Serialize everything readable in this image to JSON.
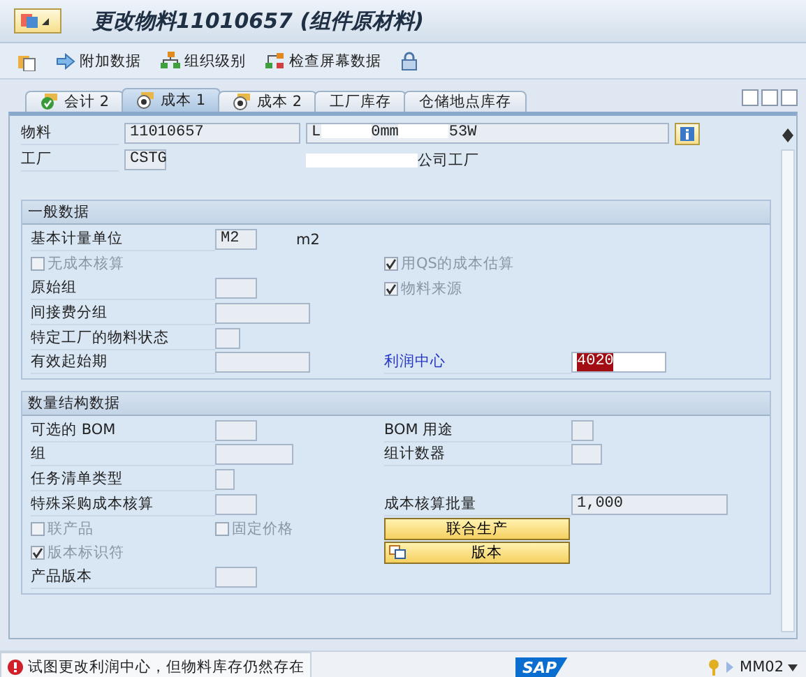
{
  "window": {
    "title": "更改物料11010657 (组件原材料)"
  },
  "toolbar": [
    {
      "kind": "new"
    },
    {
      "kind": "arrow",
      "label": "附加数据"
    },
    {
      "kind": "org",
      "label": "组织级别"
    },
    {
      "kind": "check",
      "label": "检查屏幕数据"
    },
    {
      "kind": "lock"
    }
  ],
  "tabs": [
    {
      "label": "会计 2",
      "kind": "ok",
      "selected": false
    },
    {
      "label": "成本 1",
      "kind": "target",
      "selected": true
    },
    {
      "label": "成本 2",
      "kind": "target",
      "selected": false
    },
    {
      "label": "工厂库存",
      "kind": "plain",
      "selected": false
    },
    {
      "label": "仓储地点库存",
      "kind": "plain",
      "selected": false
    }
  ],
  "header": {
    "material_label": "物料",
    "material": "11010657",
    "description_parts": [
      "L",
      "0mm",
      "53W"
    ],
    "plant_label": "工厂",
    "plant": "CSTG",
    "plant_name": "公司工厂"
  },
  "sections": [
    {
      "title": "一般数据",
      "rows": [
        {
          "left": {
            "kind": "field",
            "label": "基本计量单位",
            "value": "M2",
            "note": "m2"
          }
        },
        {
          "left": {
            "kind": "checkbox",
            "label": "无成本核算",
            "checked": false,
            "disabled": true
          },
          "right": {
            "kind": "checkbox",
            "label": "用QS的成本估算",
            "checked": true,
            "disabled": true
          }
        },
        {
          "left": {
            "kind": "field",
            "label": "原始组"
          },
          "right": {
            "kind": "checkbox",
            "label": "物料来源",
            "checked": true,
            "disabled": true
          }
        },
        {
          "left": {
            "kind": "field",
            "label": "间接费分组"
          }
        },
        {
          "left": {
            "kind": "field",
            "label": "特定工厂的物料状态"
          }
        },
        {
          "left": {
            "kind": "field",
            "label": "有效起始期"
          },
          "right": {
            "kind": "field",
            "label": "利润中心",
            "value": "4020",
            "emphasis": true,
            "selected": true,
            "editable": true
          }
        }
      ]
    },
    {
      "title": "数量结构数据",
      "rows": [
        {
          "left": {
            "kind": "field",
            "label": "可选的 BOM"
          },
          "right": {
            "kind": "field",
            "label": "BOM 用途"
          }
        },
        {
          "left": {
            "kind": "field",
            "label": "组"
          },
          "right": {
            "kind": "field",
            "label": "组计数器"
          }
        },
        {
          "left": {
            "kind": "field",
            "label": "任务清单类型"
          }
        },
        {
          "left": {
            "kind": "field",
            "label": "特殊采购成本核算"
          },
          "right": {
            "kind": "field",
            "label": "成本核算批量",
            "value": "1,000"
          }
        },
        {
          "left": {
            "kind": "checkbox",
            "label": "联产品",
            "checked": false,
            "disabled": true
          },
          "middle": {
            "kind": "checkbox",
            "label": "固定价格",
            "checked": false,
            "disabled": true
          },
          "right": {
            "kind": "button",
            "label": "联合生产",
            "icon": false
          }
        },
        {
          "left": {
            "kind": "checkbox",
            "label": "版本标识符",
            "checked": true,
            "disabled": true
          },
          "right": {
            "kind": "button",
            "label": "版本",
            "icon": true
          }
        },
        {
          "left": {
            "kind": "field",
            "label": "产品版本"
          }
        }
      ]
    }
  ],
  "status_bar": {
    "message": "试图更改利润中心，但物料库存仍然存在",
    "error": true,
    "logo": "SAP",
    "transaction": "MM02"
  }
}
